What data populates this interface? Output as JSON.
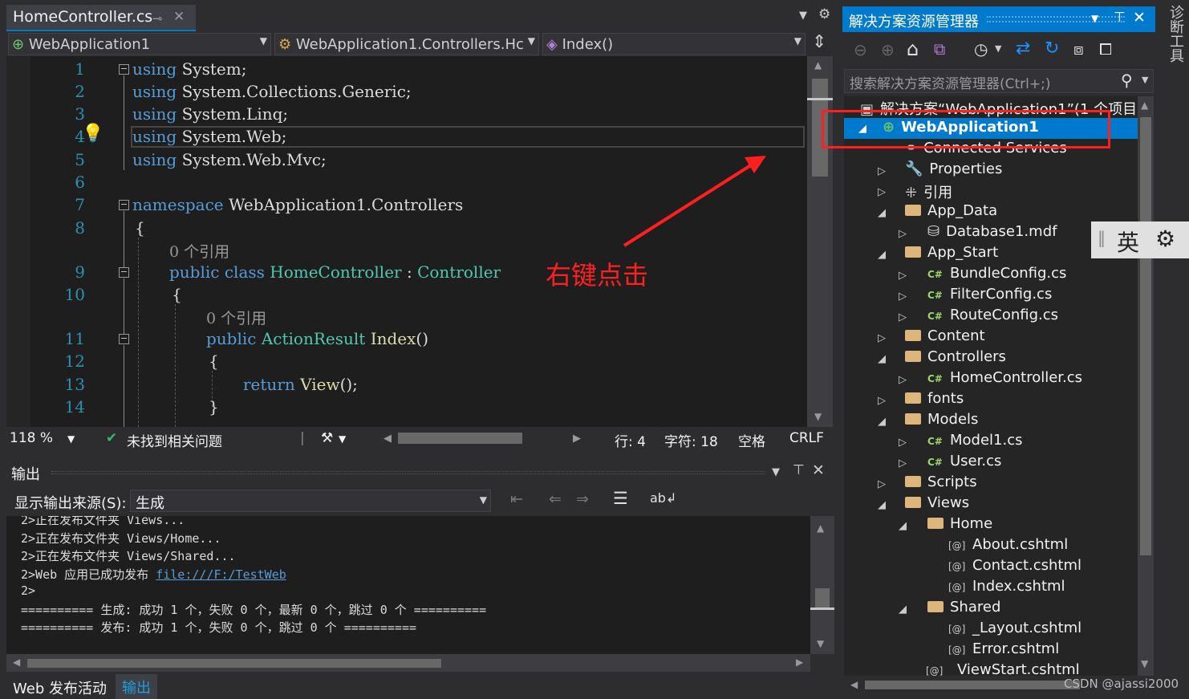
{
  "editor": {
    "tab_title": "HomeController.cs",
    "nav_project": "WebApplication1",
    "nav_class": "WebApplication1.Controllers.Hc",
    "nav_member": "Index()",
    "line_numbers": [
      "1",
      "2",
      "3",
      "4",
      "5",
      "6",
      "7",
      "8",
      "9",
      "10",
      "11",
      "12",
      "13",
      "14"
    ],
    "code": {
      "l1_kw": "using",
      "l1_ns": " System;",
      "l2_kw": "using",
      "l2_ns": " System.Collections.Generic;",
      "l3_kw": "using",
      "l3_ns": " System.Linq;",
      "l4_kw": "using",
      "l4_ns": " System.Web;",
      "l5_kw": "using",
      "l5_ns": " System.Web.Mvc;",
      "l7_kw": "namespace",
      "l7_ns": " WebApplication1.Controllers",
      "l8": "{",
      "ref1": "0 个引用",
      "l9_public": "public",
      "l9_class": "class",
      "l9_name": "HomeController",
      "l9_colon": " : ",
      "l9_base": "Controller",
      "l10": "{",
      "ref2": "0 个引用",
      "l11_public": "public",
      "l11_type": "ActionResult",
      "l11_name": "Index",
      "l11_paren": "()",
      "l12": "{",
      "l13_return": "return",
      "l13_view": "View",
      "l13_end": "();",
      "l14": "}"
    },
    "annotation": "右键点击",
    "status": {
      "zoom": "118 %",
      "issues": "未找到相关问题",
      "line": "行: 4",
      "char": "字符: 18",
      "spaces": "空格",
      "eol": "CRLF"
    }
  },
  "output": {
    "title": "输出",
    "source_label": "显示输出来源(S):",
    "source_value": "生成",
    "lines": [
      "2>正在发布文件夹 Views...",
      "2>正在发布文件夹 Views/Home...",
      "2>正在发布文件夹 Views/Shared...",
      "2>Web 应用已成功发布 ",
      "2>",
      "========== 生成: 成功 1 个，失败 0 个，最新 0 个，跳过 0 个 ==========",
      "========== 发布: 成功 1 个，失败 0 个，跳过 0 个 =========="
    ],
    "link": "file:///F:/TestWeb"
  },
  "bottom_tabs": [
    "Web 发布活动",
    "输出"
  ],
  "solution_explorer": {
    "title": "解决方案资源管理器",
    "search_placeholder": "搜索解决方案资源管理器(Ctrl+;)",
    "solution": "解决方案“WebApplication1”(1 个项目",
    "project": "WebApplication1",
    "items": [
      "Connected Services",
      "Properties",
      "引用",
      "App_Data",
      "Database1.mdf",
      "App_Start",
      "BundleConfig.cs",
      "FilterConfig.cs",
      "RouteConfig.cs",
      "Content",
      "Controllers",
      "HomeController.cs",
      "fonts",
      "Models",
      "Model1.cs",
      "User.cs",
      "Scripts",
      "Views",
      "Home",
      "About.cshtml",
      "Contact.cshtml",
      "Index.cshtml",
      "Shared",
      "_Layout.cshtml",
      "Error.cshtml",
      "_ViewStart.cshtml"
    ]
  },
  "diag_tools": "诊断工具",
  "ime": {
    "lang": "英"
  },
  "watermark": "CSDN @ajassi2000",
  "colors": {
    "accent": "#007acc",
    "annotation": "#ff1f1f",
    "keyword": "#569cd6",
    "type": "#4ec9b0"
  }
}
